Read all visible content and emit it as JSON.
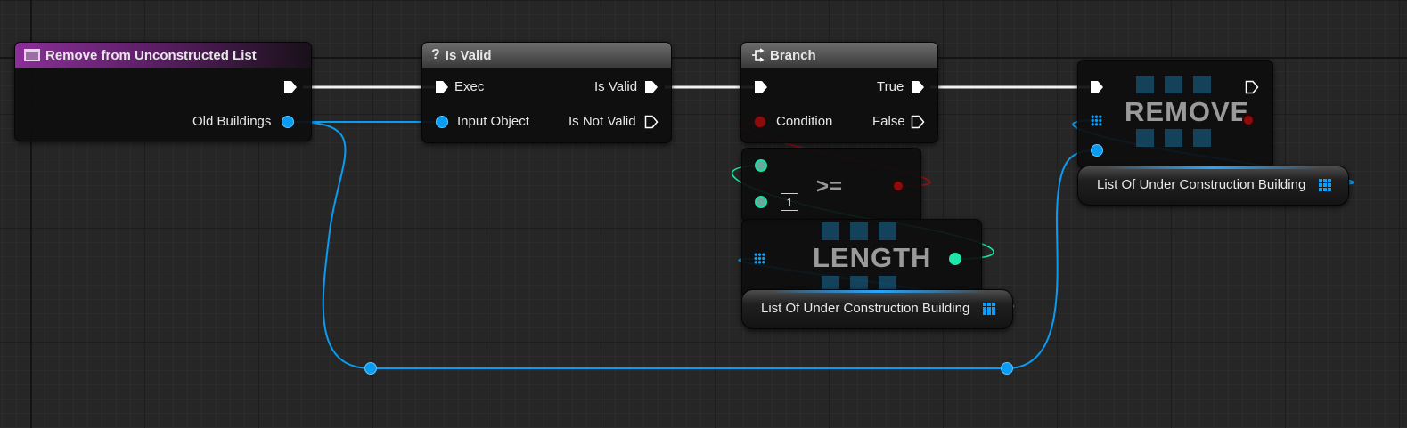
{
  "nodes": {
    "remove_from_unconstructed": {
      "title": "Remove from Unconstructed List",
      "output_label": "Old Buildings"
    },
    "is_valid": {
      "title": "Is Valid",
      "exec_in": "Exec",
      "input_object": "Input Object",
      "is_valid_out": "Is Valid",
      "is_not_valid_out": "Is Not Valid"
    },
    "branch": {
      "title": "Branch",
      "condition": "Condition",
      "true_out": "True",
      "false_out": "False"
    },
    "compare": {
      "operator": ">=",
      "default_value": "1"
    },
    "length": {
      "title": "LENGTH"
    },
    "remove": {
      "title": "REMOVE"
    },
    "var_get_1": {
      "label": "List Of Under Construction Building"
    },
    "var_get_2": {
      "label": "List Of Under Construction Building"
    }
  },
  "colors": {
    "background": "#262626",
    "exec_wire": "#ffffff",
    "object_wire": "#0a9cf0",
    "int_wire": "#1ce6a8",
    "bool_wire": "#8a0c0c",
    "function_header": "#8a2f98",
    "macro_header": "#6c6c6c"
  }
}
